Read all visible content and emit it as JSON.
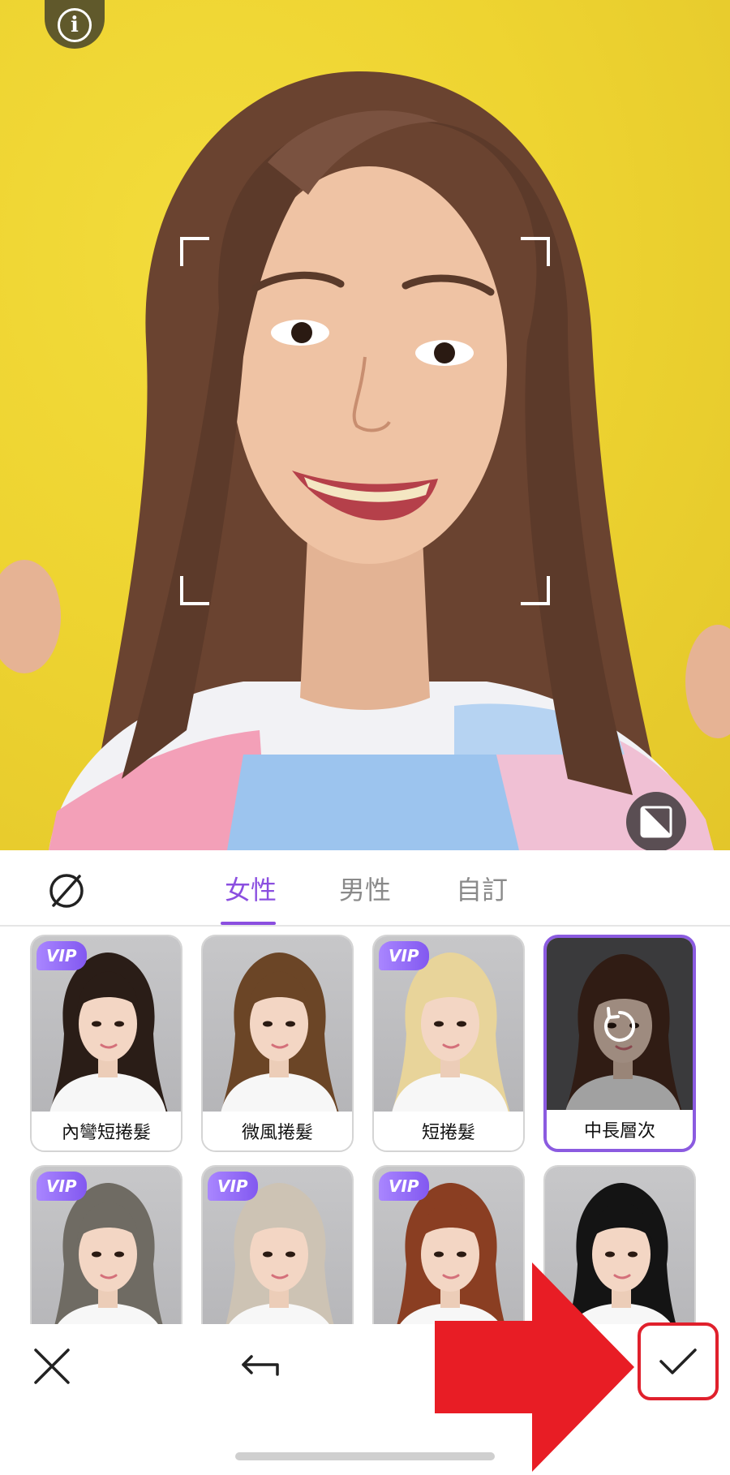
{
  "preview": {
    "info_icon": "info-icon",
    "info_glyph": "i",
    "compare_icon": "compare-icon"
  },
  "tabs": {
    "none_icon": "none-icon",
    "items": [
      {
        "label": "女性",
        "active": true
      },
      {
        "label": "男性",
        "active": false
      },
      {
        "label": "自訂",
        "active": false
      }
    ]
  },
  "hairstyles": [
    {
      "label": "內彎短捲髮",
      "vip": true,
      "selected": false,
      "hair_color": "#2a1d17"
    },
    {
      "label": "微風捲髮",
      "vip": false,
      "selected": false,
      "hair_color": "#6b4526"
    },
    {
      "label": "短捲髮",
      "vip": true,
      "selected": false,
      "hair_color": "#e8d49a"
    },
    {
      "label": "中長層次",
      "vip": false,
      "selected": true,
      "hair_color": "#4a2c20"
    },
    {
      "label": "",
      "vip": true,
      "selected": false,
      "hair_color": "#6f6b63"
    },
    {
      "label": "",
      "vip": true,
      "selected": false,
      "hair_color": "#cdc3b4"
    },
    {
      "label": "",
      "vip": true,
      "selected": false,
      "hair_color": "#8a3e22"
    },
    {
      "label": "",
      "vip": false,
      "selected": false,
      "hair_color": "#141414"
    }
  ],
  "vip_label": "VIP",
  "reset_icon": "reset-icon",
  "toolbar": {
    "close_icon": "close-icon",
    "undo_icon": "undo-icon",
    "confirm_icon": "checkmark-icon"
  },
  "colors": {
    "accent": "#8b4fe0",
    "highlight": "#e0202c",
    "background_photo": "#eed431"
  }
}
